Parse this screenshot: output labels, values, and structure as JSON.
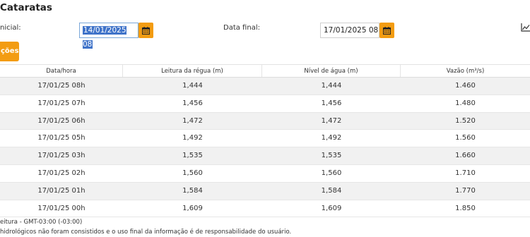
{
  "header": {
    "title": "Cataratas"
  },
  "filters": {
    "start_label": "nicial:",
    "start_value": "14/01/2025 08",
    "end_label": "Data final:",
    "end_value": "17/01/2025 08"
  },
  "icons": {
    "calendar": "calendar-icon",
    "chart": "line-chart-icon"
  },
  "colors": {
    "accent": "#f39c12",
    "selection": "#3f73c9"
  },
  "action": {
    "label": "ções"
  },
  "table": {
    "headers": [
      "Data/hora",
      "Leitura da régua (m)",
      "Nível de água (m)",
      "Vazão (m³/s)"
    ],
    "rows": [
      [
        "17/01/25 08h",
        "1,444",
        "1,444",
        "1.460"
      ],
      [
        "17/01/25 07h",
        "1,456",
        "1,456",
        "1.480"
      ],
      [
        "17/01/25 06h",
        "1,472",
        "1,472",
        "1.520"
      ],
      [
        "17/01/25 05h",
        "1,492",
        "1,492",
        "1.560"
      ],
      [
        "17/01/25 03h",
        "1,535",
        "1,535",
        "1.660"
      ],
      [
        "17/01/25 02h",
        "1,560",
        "1,560",
        "1.710"
      ],
      [
        "17/01/25 01h",
        "1,584",
        "1,584",
        "1.770"
      ],
      [
        "17/01/25 00h",
        "1,609",
        "1,609",
        "1.850"
      ]
    ]
  },
  "footer": {
    "note1": "eitura - GMT-03:00 (-03:00)",
    "note2": "hidrológicos não foram consistidos e o uso final da informação é de responsabilidade do usuário."
  }
}
